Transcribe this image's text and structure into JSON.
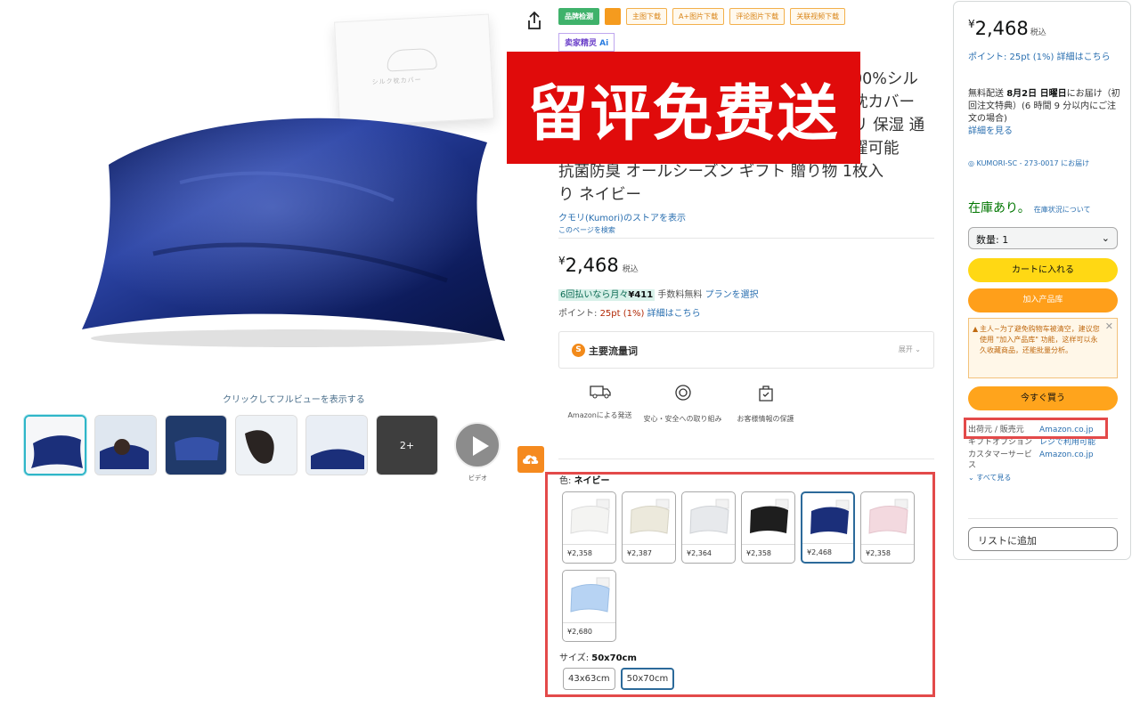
{
  "product": {
    "title": "…100%シルク枕カバー …保湿 通 …洗濯可能 抗菌防臭 オールシーズン ギフト 贈り物 1枚入り ネイビー",
    "title_lines": [
      "00%シル",
      "枕カバー",
      "リ 保湿 通",
      "濯可能",
      "抗菌防臭 オールシーズン ギフト 贈り物 1枚入",
      "り ネイビー"
    ],
    "store_link": "クモリ(Kumori)のストアを表示",
    "search_page": "このページを検索",
    "image_hint": "クリックしてフルビューを表示する",
    "box_text": "シルク枕カバー",
    "video_label": "ビデオ",
    "more_count": "2+"
  },
  "promo_banner": "留评免费送",
  "extension_toolbar": {
    "buttons": [
      "品牌检测",
      "主图下载",
      "A+图片下载",
      "评论图片下载",
      "关联视频下载"
    ],
    "ai_label": "卖家精灵",
    "ai_badge": "Ai"
  },
  "price": {
    "symbol": "¥",
    "amount": "2,468",
    "tax": "税込",
    "installment_highlight": "6回払いなら月々",
    "installment_amount": "¥411",
    "installment_fee": "手数料無料",
    "installment_link": "プランを選択",
    "points_text": "ポイント: ",
    "points_value": "25pt (1%)",
    "points_link": "詳細はこちら"
  },
  "keyword_box": {
    "icon": "S",
    "label": "主要流量词",
    "expand": "展开"
  },
  "features": [
    {
      "label": "Amazonによる発送",
      "icon": "truck-icon"
    },
    {
      "label": "安心・安全への取り組み",
      "icon": "shield-gear-icon"
    },
    {
      "label": "お客様情報の保護",
      "icon": "secure-bag-icon"
    }
  ],
  "variations": {
    "color_label": "色: ",
    "color_value": "ネイビー",
    "colors": [
      {
        "price": "¥2,358",
        "color": "#f4f4f2"
      },
      {
        "price": "¥2,387",
        "color": "#ece9dc"
      },
      {
        "price": "¥2,364",
        "color": "#e7e9ec"
      },
      {
        "price": "¥2,358",
        "color": "#1e1e1e"
      },
      {
        "price": "¥2,468",
        "color": "#1b2f7a",
        "selected": true
      },
      {
        "price": "¥2,358",
        "color": "#f3d9df"
      },
      {
        "price": "¥2,680",
        "color": "#b7d3f3"
      }
    ],
    "size_label": "サイズ: ",
    "size_value": "50x70cm",
    "sizes": [
      {
        "label": "43x63cm"
      },
      {
        "label": "50x70cm",
        "selected": true
      }
    ]
  },
  "buybox": {
    "symbol": "¥",
    "price": "2,468",
    "tax": "税込",
    "points": "ポイント: 25pt (1%) 詳細はこちら",
    "delivery_prefix": "無料配送",
    "delivery_date": "8月2日 日曜日",
    "delivery_suffix": "にお届け（初回注文特典）(6 時間 9 分以内にご注文の場合)",
    "delivery_link": "詳細を見る",
    "location": "KUMORI-SC - 273-0017 にお届け",
    "stock": "在庫あり。",
    "stock_link": "在庫状況について",
    "qty": "数量: 1",
    "add_to_cart": "カートに入れる",
    "ext_button": "加入产品库",
    "ext_notice": "主人~为了避免购物车被清空，建议您使用 \"加入产品库\" 功能，这样可以永久收藏商品，还能批量分析。",
    "buy_now": "今すぐ買う",
    "seller_rows": [
      {
        "key": "出荷元 / 販売元",
        "value": "Amazon.co.jp"
      },
      {
        "key": "ギフトオプション",
        "value": "レジで利用可能"
      },
      {
        "key": "カスタマーサービス",
        "value": "Amazon.co.jp"
      }
    ],
    "see_all": "すべて見る",
    "add_to_list": "リストに追加"
  },
  "colors": {
    "promo_red": "#e00b0b",
    "highlight_frame": "#e34a4a",
    "cart_yellow": "#ffd814",
    "buy_orange": "#ffa41c",
    "in_stock_green": "#007600",
    "link_blue": "#2a6fb0",
    "pillow_navy": "#1b2f7a"
  }
}
